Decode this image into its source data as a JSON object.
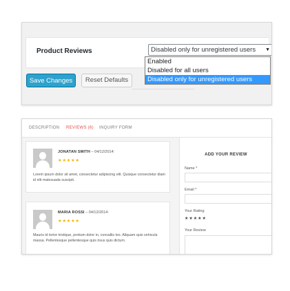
{
  "settings": {
    "label": "Product Reviews",
    "selected": "Disabled only for unregistered users",
    "select_arrow": "▼",
    "options": [
      "Enabled",
      "Disabled for all users",
      "Disabled only for unregistered users"
    ],
    "save_label": "Save Changes",
    "reset_label": "Reset Defaults"
  },
  "tabs": [
    "DESCRIPTION",
    "REVIEWS (6)",
    "INQUIRY FORM"
  ],
  "reviews": [
    {
      "author": "JONATAN SMITH",
      "date": " – 04/12/2014:",
      "stars": "★★★★★",
      "text": "Lorem ipsum dolor sit amet, consectetur adipiscing elit. Quisque consectetur diam id elit malesuada suscipit."
    },
    {
      "author": "MARIA ROSSI",
      "date": " – 04/12/2014:",
      "stars": "★★★★★",
      "text": "Mauris id tortor tristique, pretium dolor in, convallis leo. Aliquam quis vehicula massa. Pellentesque pellentesque quis risus quis dictum."
    }
  ],
  "form": {
    "title": "ADD YOUR REVIEW",
    "name_label": "Name *",
    "email_label": "Email *",
    "rating_label": "Your Rating",
    "rating_stars": "★★★★★",
    "review_label": "Your Review"
  },
  "colors": {
    "primary_button": "#2ea2cc",
    "active_tab": "#e14d43",
    "star": "#f0b90b",
    "dropdown_highlight": "#3399ff"
  }
}
